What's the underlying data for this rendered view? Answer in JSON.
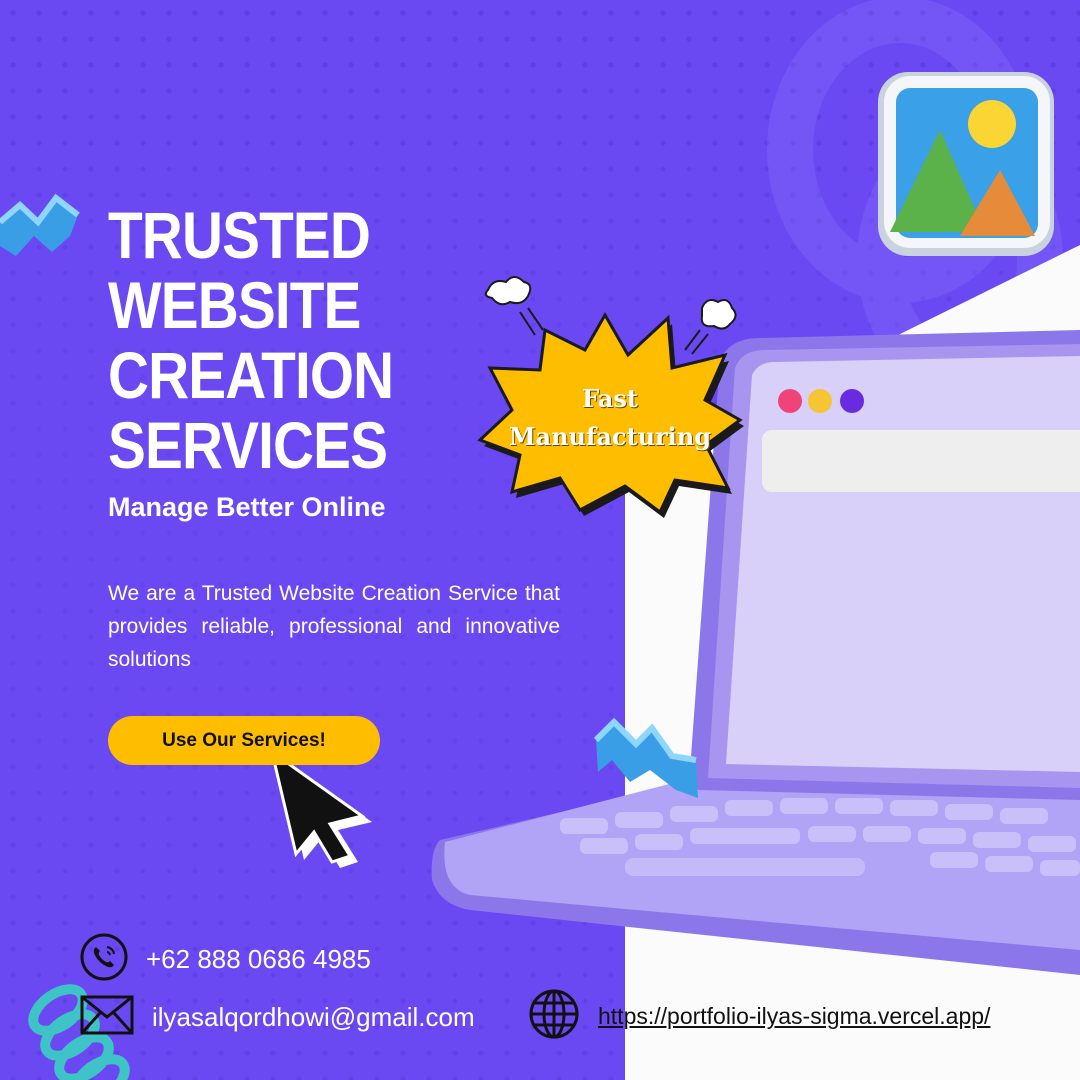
{
  "hero": {
    "title_lines": [
      "TRUSTED WEBSITE",
      "CREATION",
      "SERVICES"
    ],
    "subtitle": "Manage Better Online",
    "description": "We are a Trusted Website Creation Service that provides reliable, professional and innovative solutions",
    "cta_label": "Use Our Services!"
  },
  "badge": {
    "line1": "Fast",
    "line2": "Manufacturing"
  },
  "contacts": {
    "phone": "+62 888 0686 4985",
    "email": "ilyasalqordhowi@gmail.com",
    "website": "https://portfolio-ilyas-sigma.vercel.app/"
  },
  "icons": {
    "phone": "phone-icon",
    "email": "envelope-icon",
    "website": "globe-icon",
    "pointer": "mouse-cursor-icon",
    "gallery": "image-gallery-icon"
  },
  "colors": {
    "background": "#6a49f2",
    "accent": "#ffbd00",
    "laptop": "#a795f0",
    "screen": "#d9d0fa"
  }
}
